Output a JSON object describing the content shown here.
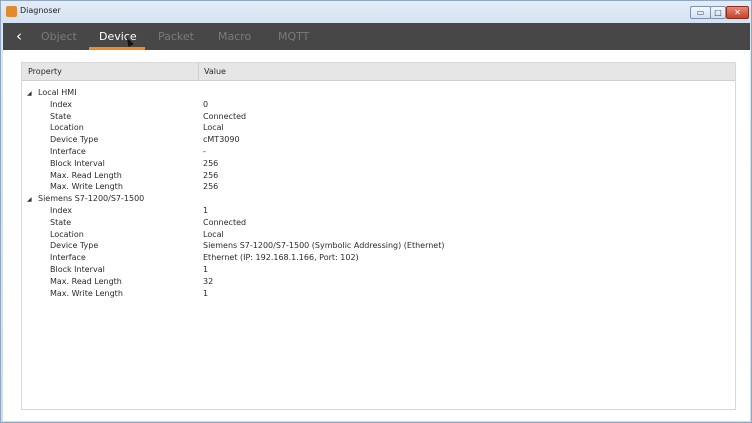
{
  "window": {
    "title": "Diagnoser",
    "min_glyph": "▭",
    "max_glyph": "□",
    "close_glyph": "✕"
  },
  "nav": {
    "back_glyph": "‹",
    "tabs": [
      {
        "label": "Object",
        "active": false
      },
      {
        "label": "Device",
        "active": true
      },
      {
        "label": "Packet",
        "active": false
      },
      {
        "label": "Macro",
        "active": false
      },
      {
        "label": "MQTT",
        "active": false
      }
    ]
  },
  "table": {
    "columns": {
      "property": "Property",
      "value": "Value"
    },
    "groups": [
      {
        "name": "Local HMI",
        "rows": [
          {
            "property": "Index",
            "value": "0"
          },
          {
            "property": "State",
            "value": "Connected"
          },
          {
            "property": "Location",
            "value": "Local"
          },
          {
            "property": "Device Type",
            "value": "cMT3090"
          },
          {
            "property": "Interface",
            "value": "-"
          },
          {
            "property": "Block Interval",
            "value": "256"
          },
          {
            "property": "Max. Read Length",
            "value": "256"
          },
          {
            "property": "Max. Write Length",
            "value": "256"
          }
        ]
      },
      {
        "name": "Siemens S7-1200/S7-1500",
        "rows": [
          {
            "property": "Index",
            "value": "1"
          },
          {
            "property": "State",
            "value": "Connected"
          },
          {
            "property": "Location",
            "value": "Local"
          },
          {
            "property": "Device Type",
            "value": "Siemens S7-1200/S7-1500 (Symbolic Addressing) (Ethernet)"
          },
          {
            "property": "Interface",
            "value": "Ethernet (IP: 192.168.1.166, Port: 102)"
          },
          {
            "property": "Block Interval",
            "value": "1"
          },
          {
            "property": "Max. Read Length",
            "value": "32"
          },
          {
            "property": "Max. Write Length",
            "value": "1"
          }
        ]
      }
    ],
    "expand_glyph": "◢"
  },
  "colors": {
    "navbar": "#474747",
    "active_tab": "#ffffff",
    "inactive_tab": "#7a7a7a",
    "accent": "#f08a24"
  }
}
